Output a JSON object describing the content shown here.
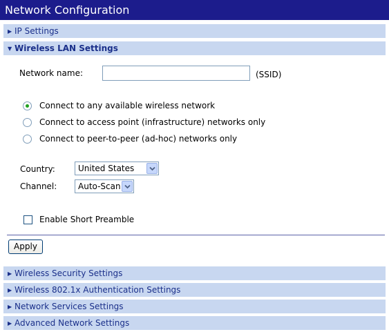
{
  "page": {
    "title": "Network Configuration"
  },
  "sections": {
    "ip": {
      "label": "IP Settings",
      "expanded": false
    },
    "wireless_lan": {
      "label": "Wireless LAN Settings",
      "expanded": true
    },
    "wireless_security": {
      "label": "Wireless Security Settings",
      "expanded": false
    },
    "wireless_8021x": {
      "label": "Wireless 802.1x Authentication Settings",
      "expanded": false
    },
    "network_services": {
      "label": "Network Services Settings",
      "expanded": false
    },
    "advanced_network": {
      "label": "Advanced Network Settings",
      "expanded": false
    }
  },
  "wireless": {
    "network_name_label": "Network name:",
    "network_name_value": "",
    "ssid_suffix": "(SSID)",
    "connection_options": [
      {
        "label": "Connect to any available wireless network",
        "checked": true
      },
      {
        "label": "Connect to access point (infrastructure) networks only",
        "checked": false
      },
      {
        "label": "Connect to peer-to-peer (ad-hoc) networks only",
        "checked": false
      }
    ],
    "country_label": "Country:",
    "country_value": "United States",
    "channel_label": "Channel:",
    "channel_value": "Auto-Scan",
    "short_preamble_label": "Enable Short Preamble",
    "short_preamble_checked": false,
    "apply_label": "Apply"
  },
  "colors": {
    "title_bar": "#1c1c8c",
    "section_header_bg": "#c8d7f0",
    "section_header_text": "#1a2f8a",
    "radio_selected": "#21a121"
  },
  "icons": {
    "collapsed": "triangle-right-icon",
    "expanded": "triangle-down-icon",
    "dropdown": "chevron-down-icon"
  }
}
